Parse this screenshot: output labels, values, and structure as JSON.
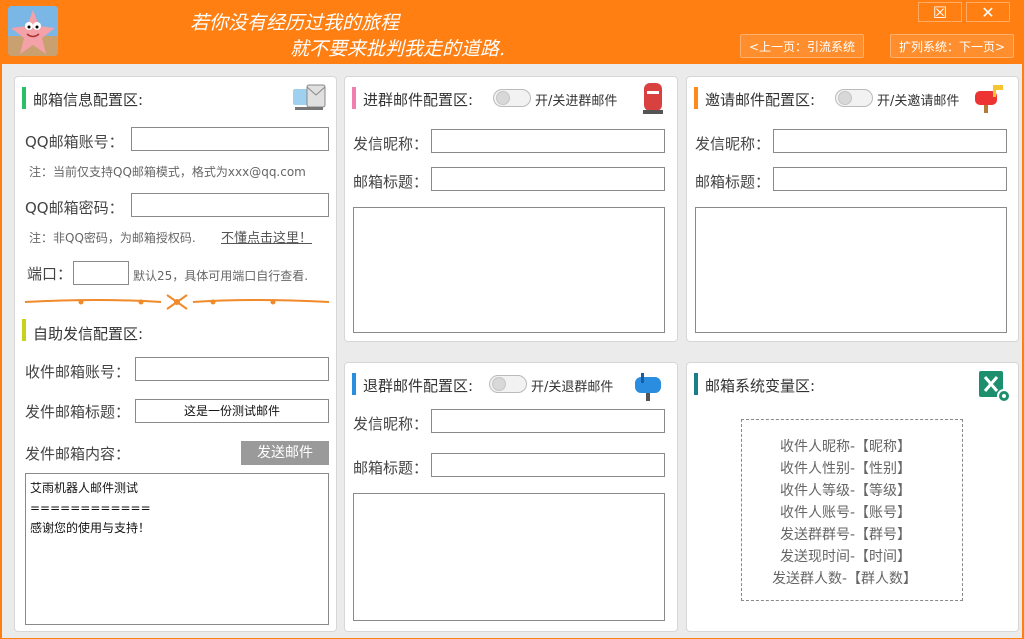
{
  "header": {
    "slogan_line1": "若你没有经历过我的旅程",
    "slogan_line2": "就不要来批判我走的道路.",
    "min_icon": "☒",
    "close_icon": "✕",
    "prev_button": "<上一页：引流系统",
    "next_button": "扩列系统：下一页>"
  },
  "mail_info": {
    "title": "邮箱信息配置区:",
    "qq_account_label": "QQ邮箱账号：",
    "qq_account_value": "",
    "qq_account_note": "注：当前仅支持QQ邮箱模式，格式为xxx@qq.com",
    "qq_password_label": "QQ邮箱密码：",
    "qq_password_value": "",
    "qq_password_note": "注：非QQ密码，为邮箱授权码.",
    "help_link": "不懂点击这里！",
    "port_label": "端口：",
    "port_value": "",
    "port_note": "默认25，具体可用端口自行查看."
  },
  "self_send": {
    "title": "自助发信配置区:",
    "recipient_label": "收件邮箱账号：",
    "recipient_value": "",
    "subject_label": "发件邮箱标题：",
    "subject_value": "这是一份测试邮件",
    "content_label": "发件邮箱内容：",
    "send_button": "发送邮件",
    "content_lines": [
      "艾雨机器人邮件测试",
      "============",
      "感谢您的使用与支持！"
    ]
  },
  "join_mail": {
    "title": "进群邮件配置区:",
    "toggle_label": "开/关进群邮件",
    "nickname_label": "发信昵称：",
    "subject_label": "邮箱标题："
  },
  "invite_mail": {
    "title": "邀请邮件配置区:",
    "toggle_label": "开/关邀请邮件",
    "nickname_label": "发信昵称：",
    "subject_label": "邮箱标题："
  },
  "leave_mail": {
    "title": "退群邮件配置区:",
    "toggle_label": "开/关退群邮件",
    "nickname_label": "发信昵称：",
    "subject_label": "邮箱标题："
  },
  "variables": {
    "title": "邮箱系统变量区:",
    "items": [
      "收件人昵称-【昵称】",
      "收件人性别-【性别】",
      "收件人等级-【等级】",
      "收件人账号-【账号】",
      "发送群群号-【群号】",
      "发送现时间-【时间】",
      "发送群人数-【群人数】"
    ]
  },
  "colors": {
    "brand_orange": "#ff7f12",
    "bar_green": "#2bbf6a",
    "bar_yellow": "#c8d21e",
    "bar_pink": "#f07fb0",
    "bar_orange": "#ff8a1c",
    "bar_blue": "#2a8de0",
    "bar_teal": "#1a7e86"
  }
}
